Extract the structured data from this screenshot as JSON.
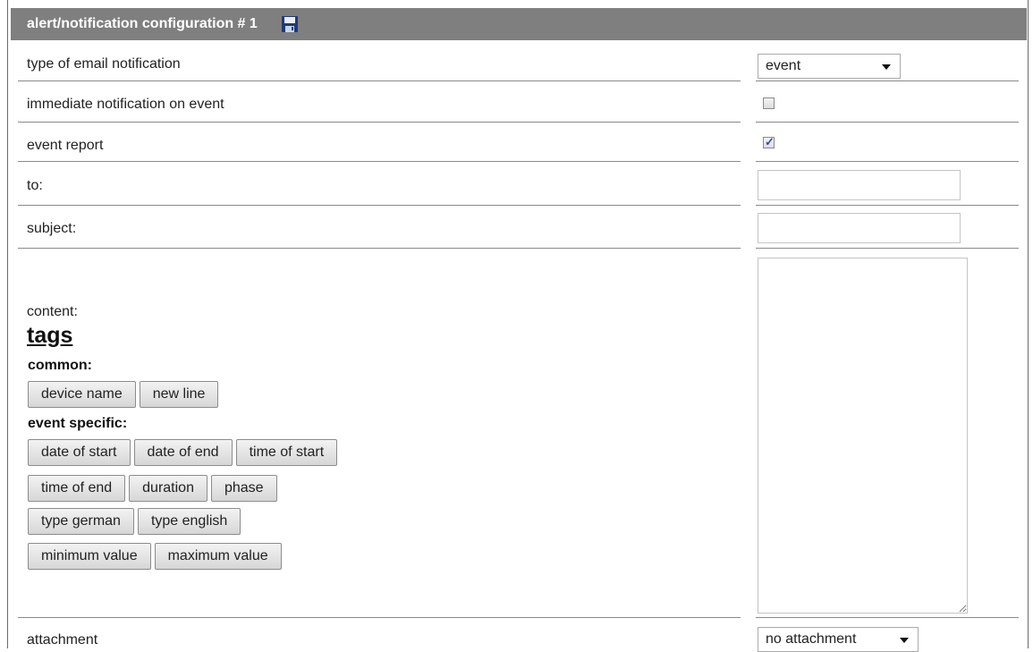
{
  "header": {
    "title": "alert/notification configuration # 1",
    "save_icon": "floppy-disk-icon"
  },
  "rows": {
    "email_type_label": "type of email notification",
    "email_type_value": "event",
    "immediate_label": "immediate notification on event",
    "immediate_checked": false,
    "event_report_label": "event report",
    "event_report_checked": true,
    "to_label": "to:",
    "to_value": "",
    "subject_label": "subject:",
    "subject_value": "",
    "content_label": "content:",
    "content_value": "",
    "attachment_label": "attachment",
    "attachment_value": "no attachment"
  },
  "tags": {
    "title": "tags",
    "common_title": "common:",
    "common": [
      "device name",
      "new line"
    ],
    "event_title": "event specific:",
    "event_row1": [
      "date of start",
      "date of end",
      "time of start"
    ],
    "event_row2": [
      "time of end",
      "duration",
      "phase"
    ],
    "event_row3": [
      "type german",
      "type english"
    ],
    "event_row4": [
      "minimum value",
      "maximum value"
    ]
  },
  "colors": {
    "header_bg": "#7f7f7f",
    "checkmark": "#2a4fb0"
  }
}
